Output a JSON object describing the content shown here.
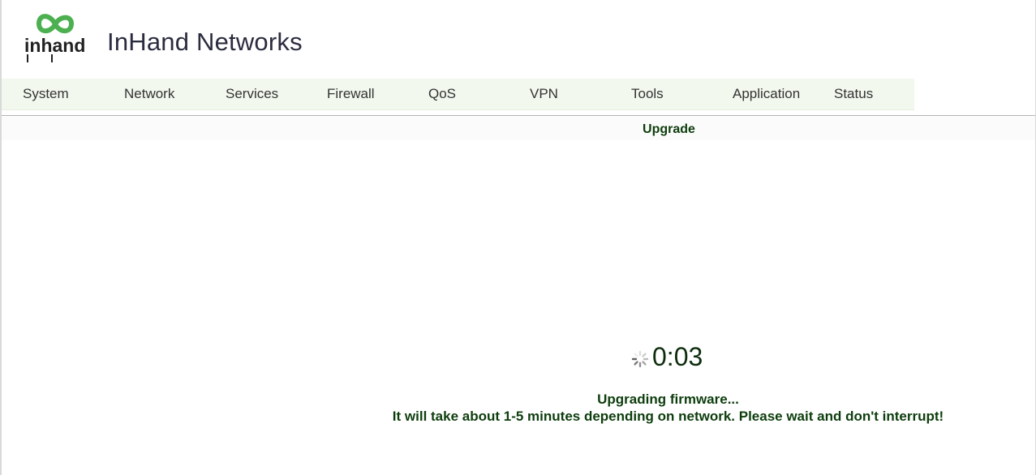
{
  "brand": {
    "logo_text": "inhand",
    "title": "InHand Networks",
    "logo_color": "#4caf50"
  },
  "nav": {
    "items": [
      {
        "label": "System"
      },
      {
        "label": "Network"
      },
      {
        "label": "Services"
      },
      {
        "label": "Firewall"
      },
      {
        "label": "QoS"
      },
      {
        "label": "VPN"
      },
      {
        "label": "Tools"
      },
      {
        "label": "Application"
      },
      {
        "label": "Status"
      }
    ]
  },
  "page": {
    "title": "Upgrade"
  },
  "progress": {
    "elapsed": "0:03",
    "spinner_icon": "loading-spinner-icon",
    "status": "Upgrading firmware...",
    "notice": "It will take about 1-5 minutes depending on network. Please wait and don't interrupt!"
  }
}
